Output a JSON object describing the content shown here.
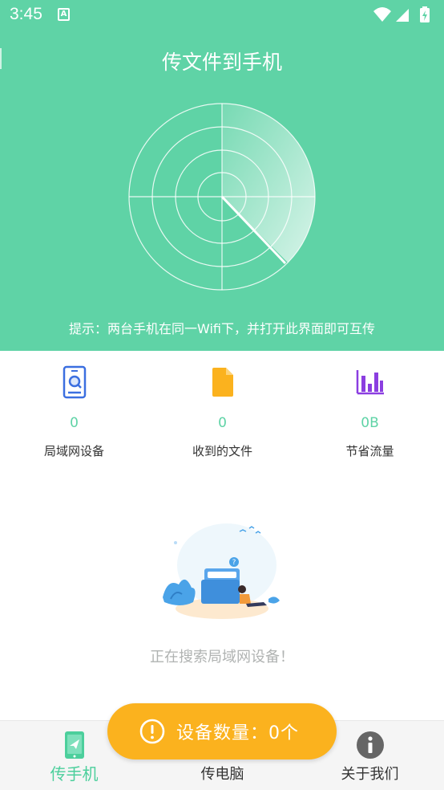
{
  "status_bar": {
    "time": "3:45",
    "notification_badge": "A"
  },
  "header": {
    "title": "传文件到手机"
  },
  "hint": "提示：两台手机在同一Wifi下，并打开此界面即可互传",
  "stats": [
    {
      "value": "0",
      "label": "局域网设备",
      "icon": "phone-search-icon",
      "color": "#3b6fe0"
    },
    {
      "value": "0",
      "label": "收到的文件",
      "icon": "file-icon",
      "color": "#fbb21e"
    },
    {
      "value": "0B",
      "label": "节省流量",
      "icon": "bar-chart-icon",
      "color": "#8b3ee0"
    }
  ],
  "empty_state": {
    "text": "正在搜索局域网设备！"
  },
  "toast": {
    "text": "设备数量：0个"
  },
  "bottom_nav": [
    {
      "label": "传手机",
      "icon": "phone-send-icon",
      "active": true
    },
    {
      "label": "传电脑",
      "icon": "computer-icon",
      "active": false
    },
    {
      "label": "关于我们",
      "icon": "info-icon",
      "active": false
    }
  ],
  "colors": {
    "accent": "#5fd3a6",
    "toast": "#fbb21e",
    "muted": "#b0b3b2"
  }
}
